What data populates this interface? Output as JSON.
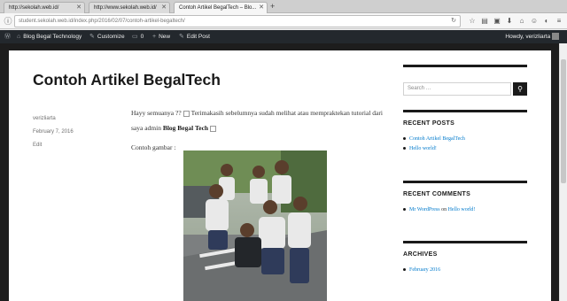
{
  "browser": {
    "tabs": [
      {
        "label": "http://sekolah.web.id/"
      },
      {
        "label": "http://www.sekolah.web.id/"
      },
      {
        "label": "Contoh Artikel BegalTech – Blo..."
      }
    ],
    "url": "student.sekolah.web.id/index.php/2016/02/07/contoh-artikel-begaltech/"
  },
  "adminbar": {
    "site_name": "Blog Begal Technology",
    "customize": "Customize",
    "comments_count": "0",
    "new": "New",
    "edit_post": "Edit Post",
    "howdy": "Howdy, verizliarta"
  },
  "post": {
    "title": "Contoh Artikel BegalTech",
    "author": "verizliarta",
    "date": "February 7, 2016",
    "edit": "Edit",
    "para1_a": "Hayy semuanya ??",
    "para1_b": "Terimakasih sebelumnya sudah melihat atau mempraktekan tutorial dari saya admin",
    "para1_strong": "Blog Begal Tech",
    "caption": "Contoh gambar :"
  },
  "sidebar": {
    "search_placeholder": "Search …",
    "recent_posts": {
      "title": "RECENT POSTS",
      "items": [
        "Contoh Artikel BegalTech",
        "Hello world!"
      ]
    },
    "recent_comments": {
      "title": "RECENT COMMENTS",
      "author": "Mr WordPress",
      "on": "on",
      "post": "Hello world!"
    },
    "archives": {
      "title": "ARCHIVES",
      "items": [
        "February 2016"
      ]
    }
  }
}
